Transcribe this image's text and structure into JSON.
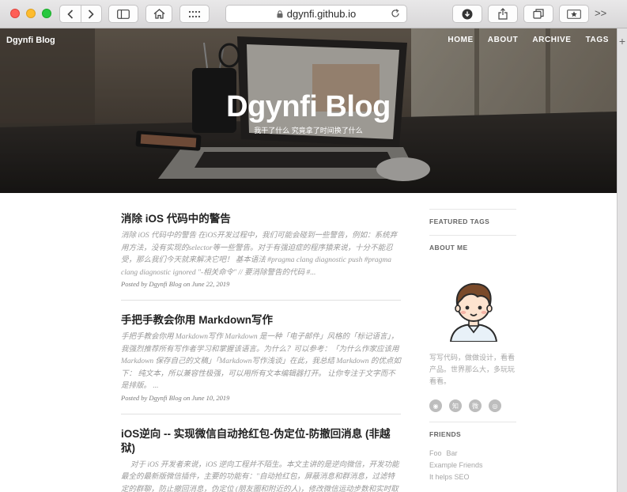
{
  "browser": {
    "url": "dgynfi.github.io",
    "overflow_label": ">>",
    "new_tab_label": "+"
  },
  "site": {
    "brand": "Dgynfi Blog",
    "nav": [
      "HOME",
      "ABOUT",
      "ARCHIVE",
      "TAGS"
    ],
    "hero_title": "Dgynfi Blog",
    "hero_subtitle": "我干了什么 究竟拿了时间换了什么"
  },
  "posts": [
    {
      "title": "消除 iOS 代码中的警告",
      "excerpt": "消除 iOS 代码中的警告 在iOS开发过程中，我们可能会碰到一些警告，例如：系统弃用方法，没有实现的selector等一些警告。对于有强迫症的程序猿来说，十分不能忍受，那么我们今天就来解决它吧！ 基本语法 #pragma clang diagnostic push #pragma clang diagnostic ignored \"-相关命令\" // 要消除警告的代码 #...",
      "meta": "Posted by Dgynfi Blog on June 22, 2019"
    },
    {
      "title": "手把手教会你用 Markdown写作",
      "excerpt": "手把手教会你用 Markdown写作 Markdown 是一种「电子邮件」风格的「标记语言」，我强烈推荐所有写作者学习和掌握该语言。为什么？可以参考：「为什么作家应该用 Markdown 保存自己的文稿」「Markdown写作浅谈」在此，我总结 Markdown 的优点如下： 纯文本，所以兼容性极强，可以用所有文本编辑器打开。 让你专注于文字而不是排版。 ...",
      "meta": "Posted by Dgynfi Blog on June 10, 2019"
    },
    {
      "title": "iOS逆向 -- 实现微信自动抢红包-伪定位-防撤回消息 (非越狱)",
      "excerpt": "对于 iOS 开发者来说，iOS 逆向工程并不陌生。本文主讲的是逆向微信，开发功能最全的最新版微信插件，主要的功能有：\"自动抢红包，屏蔽消息和群消息，过滤特定的群聊，防止撤回消息，伪定位 (朋友圈和附近的人)，修改微信运动步数和实时取景做",
      "meta": ""
    }
  ],
  "sidebar": {
    "featured_tags_heading": "FEATURED TAGS",
    "about_heading": "ABOUT ME",
    "about_text": "写写代码，做做设计，看看产品。世界那么大，多玩玩看看。",
    "social_icons": [
      "rss-icon",
      "zhihu-icon",
      "weibo-icon",
      "github-icon"
    ],
    "social_glyphs": [
      "◉",
      "知",
      "微",
      "◎"
    ],
    "friends_heading": "FRIENDS",
    "friends": [
      "Foo",
      "Bar",
      "Example Friends",
      "It helps SEO"
    ]
  }
}
